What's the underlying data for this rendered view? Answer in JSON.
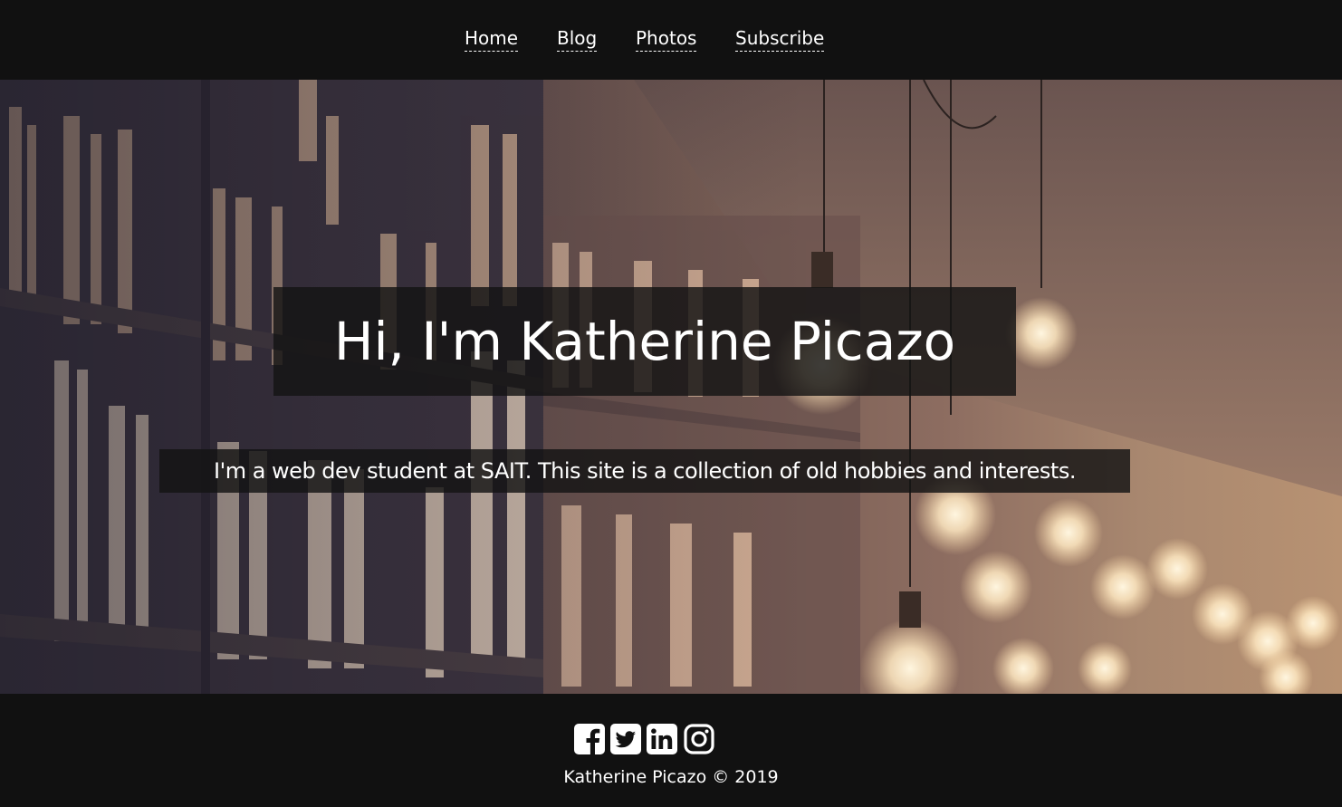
{
  "nav": {
    "items": [
      {
        "label": "Home"
      },
      {
        "label": "Blog"
      },
      {
        "label": "Photos"
      },
      {
        "label": "Subscribe"
      }
    ]
  },
  "hero": {
    "title": "Hi, I'm Katherine Picazo",
    "subtitle": "I'm a web dev student at SAIT. This site is a collection of old hobbies and interests.",
    "background_description_icon": "library-bookshelf-lightbulbs-photo"
  },
  "footer": {
    "social": [
      {
        "icon": "facebook-icon"
      },
      {
        "icon": "twitter-icon"
      },
      {
        "icon": "linkedin-icon"
      },
      {
        "icon": "instagram-icon"
      }
    ],
    "copyright": "Katherine Picazo © 2019"
  },
  "colors": {
    "bar_background": "#111111",
    "text": "#ffffff"
  }
}
